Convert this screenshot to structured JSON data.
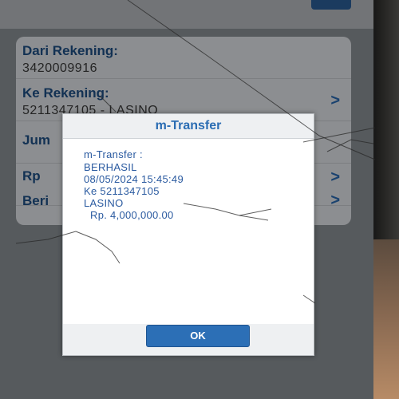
{
  "form": {
    "rows": [
      {
        "label": "Dari Rekening:",
        "value": "3420009916",
        "has_chevron": false
      },
      {
        "label": "Ke Rekening:",
        "value": "5211347105 - LASINO",
        "has_chevron": true
      },
      {
        "label": "Jum",
        "value": "",
        "has_chevron": false
      },
      {
        "label": "Rp",
        "value": "",
        "has_chevron": true
      },
      {
        "label": "Beri",
        "value": "",
        "has_chevron": true
      }
    ],
    "chevron_glyph": ">"
  },
  "dialog": {
    "title": "m-Transfer",
    "lines": [
      "m-Transfer :",
      "BERHASIL",
      "08/05/2024 15:45:49",
      "Ke 5211347105",
      "LASINO",
      "Rp. 4,000,000.00"
    ],
    "ok_label": "OK"
  },
  "colors": {
    "accent": "#2b6db3",
    "label_blue": "#1e4f86",
    "ok_button": "#2c6fb6"
  }
}
